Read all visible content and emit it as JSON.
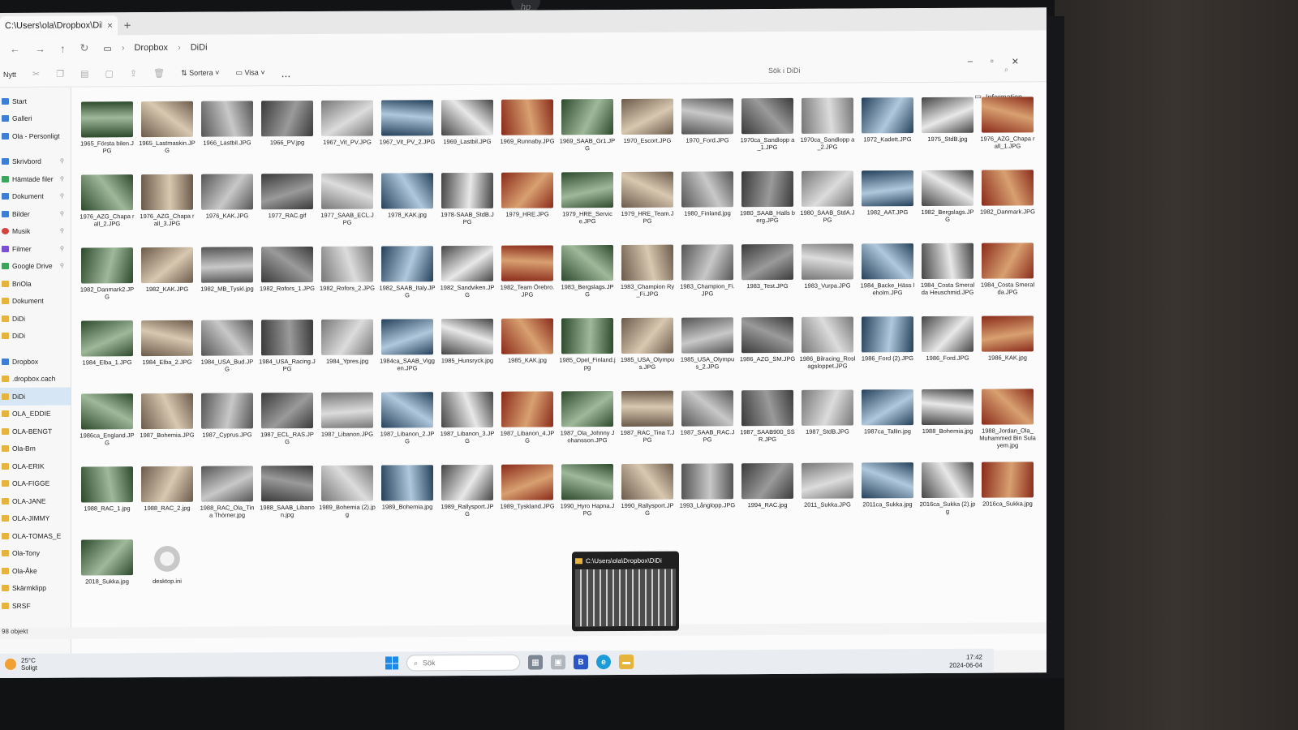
{
  "window": {
    "tab_title": "C:\\Users\\ola\\Dropbox\\DiDi",
    "tab_close": "×",
    "new_tab": "+",
    "breadcrumb": [
      "Dropbox",
      "DiDi"
    ],
    "search_placeholder": "Sök i DiDi"
  },
  "toolbar": {
    "new_label": "Nytt",
    "sort_label": "Sortera",
    "view_label": "Visa",
    "more_label": "...",
    "info_label": "Information"
  },
  "sidebar": {
    "items": [
      {
        "label": "Start",
        "icon": "home-icon"
      },
      {
        "label": "Galleri",
        "icon": "gallery-icon"
      },
      {
        "label": "Ola - Personligt",
        "icon": "cloud-icon"
      },
      {
        "label": "Skrivbord",
        "icon": "desktop-icon"
      },
      {
        "label": "Hämtade filer",
        "icon": "download-icon"
      },
      {
        "label": "Dokument",
        "icon": "document-icon"
      },
      {
        "label": "Bilder",
        "icon": "pictures-icon"
      },
      {
        "label": "Musik",
        "icon": "music-icon"
      },
      {
        "label": "Filmer",
        "icon": "video-icon"
      },
      {
        "label": "Google Drive",
        "icon": "google-drive-icon"
      },
      {
        "label": "BriOla",
        "icon": "folder-icon"
      },
      {
        "label": "Dokument",
        "icon": "folder-icon"
      },
      {
        "label": "DiDi",
        "icon": "folder-icon"
      },
      {
        "label": "DiDi",
        "icon": "folder-icon"
      },
      {
        "label": "Dropbox",
        "icon": "dropbox-icon"
      },
      {
        "label": ".dropbox.cach",
        "icon": "folder-icon"
      },
      {
        "label": "DiDi",
        "icon": "folder-icon"
      },
      {
        "label": "OLA_EDDIE",
        "icon": "folder-icon"
      },
      {
        "label": "OLA-BENGT",
        "icon": "folder-icon"
      },
      {
        "label": "Ola-Bm",
        "icon": "folder-icon"
      },
      {
        "label": "OLA-ERIK",
        "icon": "folder-icon"
      },
      {
        "label": "OLA-FIGGE",
        "icon": "folder-icon"
      },
      {
        "label": "OLA-JANE",
        "icon": "folder-icon"
      },
      {
        "label": "OLA-JIMMY",
        "icon": "folder-icon"
      },
      {
        "label": "OLA-TOMAS_E",
        "icon": "folder-icon"
      },
      {
        "label": "Ola-Tony",
        "icon": "folder-icon"
      },
      {
        "label": "Ola-Åke",
        "icon": "folder-icon"
      },
      {
        "label": "Skärmklipp",
        "icon": "folder-icon"
      },
      {
        "label": "SRSF",
        "icon": "folder-icon"
      }
    ]
  },
  "files": [
    "1965_Första bilen.JPG",
    "1965_Lastmaskin.JPG",
    "1966_Lastbil.JPG",
    "1966_PV.jpg",
    "1967_Vit_PV.JPG",
    "1967_Vit_PV_2.JPG",
    "1969_Lastbil.JPG",
    "1969_Runnaby.JPG",
    "1969_SAAB_Gr1.JPG",
    "1970_Escort.JPG",
    "1970_Ford.JPG",
    "1970ca_Sandlopp a_1.JPG",
    "1970ca_Sandlopp a_2.JPG",
    "1972_Kadett.JPG",
    "1975_StdB.jpg",
    "1976_AZG_Chapa rall_1.JPG",
    "1976_AZG_Chapa rall_2.JPG",
    "1976_AZG_Chapa rall_3.JPG",
    "1976_KAK.JPG",
    "1977_RAC.gif",
    "1977_SAAB_ECL.JPG",
    "1978_KAK.jpg",
    "1978-SAAB_StdB.JPG",
    "1979_HRE.JPG",
    "1979_HRE_Servic e.JPG",
    "1979_HRE_Team.JPG",
    "1980_Finland.jpg",
    "1980_SAAB_Halls berg.JPG",
    "1980_SAAB_StdA.JPG",
    "1982_AAT.JPG",
    "1982_Bergslags.JPG",
    "1982_Danmark.JPG",
    "1982_Danmark2.JPG",
    "1982_KAK.JPG",
    "1982_MB_Tyskl.jpg",
    "1982_Rofors_1.JPG",
    "1982_Rofors_2.JPG",
    "1982_SAAB_Italy.JPG",
    "1982_Sandviken.JPG",
    "1982_Team Örebro.JPG",
    "1983_Bergslags.JPG",
    "1983_Champion Ry_Fi.JPG",
    "1983_Champion_Fi.JPG",
    "1983_Test.JPG",
    "1983_Vurpa.JPG",
    "1984_Backe_Häss leholm.JPG",
    "1984_Costa Smeralda Heuschmid.JPG",
    "1984_Costa Smeralda.JPG",
    "1984_Elba_1.JPG",
    "1984_Elba_2.JPG",
    "1984_USA_Bud.JPG",
    "1984_USA_Racing.JPG",
    "1984_Ypres.jpg",
    "1984ca_SAAB_Viggen.JPG",
    "1985_Hunsryck.jpg",
    "1985_KAK.jpg",
    "1985_Opel_Finland.jpg",
    "1985_USA_Olympus.JPG",
    "1985_USA_Olympus_2.JPG",
    "1986_AZG_SM.JPG",
    "1986_Bilracing_Roslagsloppet.JPG",
    "1986_Ford (2).JPG",
    "1986_Ford.JPG",
    "1986_KAK.jpg",
    "1986ca_England.JPG",
    "1987_Bohemia.JPG",
    "1987_Cyprus.JPG",
    "1987_ECL_RAS.JPG",
    "1987_Libanon.JPG",
    "1987_Libanon_2.JPG",
    "1987_Libanon_3.JPG",
    "1987_Libanon_4.JPG",
    "1987_Ola_Johnny Johansson.JPG",
    "1987_RAC_Tina T.JPG",
    "1987_SAAB_RAC.JPG",
    "1987_SAAB900_SSR.JPG",
    "1987_StdB.JPG",
    "1987ca_Tallin.jpg",
    "1988_Bohemia.jpg",
    "1988_Jordan_Ola_Muhammed Bin Sulayem.jpg",
    "1988_RAC_1.jpg",
    "1988_RAC_2.jpg",
    "1988_RAC_Ola_Tina Thörner.jpg",
    "1988_SAAB_Libanon.jpg",
    "1989_Bohemia (2).jpg",
    "1989_Bohemia.jpg",
    "1989_Rallysport.JPG",
    "1989_Tyskland.JPG",
    "1990_Hyro Hapna.JPG",
    "1990_Rallysport.JPG",
    "1993_Långlopp.JPG",
    "1994_RAC.jpg",
    "2011_Sukka.JPG",
    "2011ca_Sukka.jpg",
    "2016ca_Sukka (2).jpg",
    "2016ca_Sukka.jpg",
    "2018_Sukka.jpg",
    "desktop.ini"
  ],
  "status": {
    "count": "98 objekt"
  },
  "preview": {
    "title": "C:\\Users\\ola\\Dropbox\\DiDi"
  },
  "taskbar": {
    "temperature": "25°C",
    "weather": "Soligt",
    "search_placeholder": "Sök",
    "time": "17:42",
    "date": "2024-06-04"
  },
  "brand": {
    "logo": "hp"
  }
}
